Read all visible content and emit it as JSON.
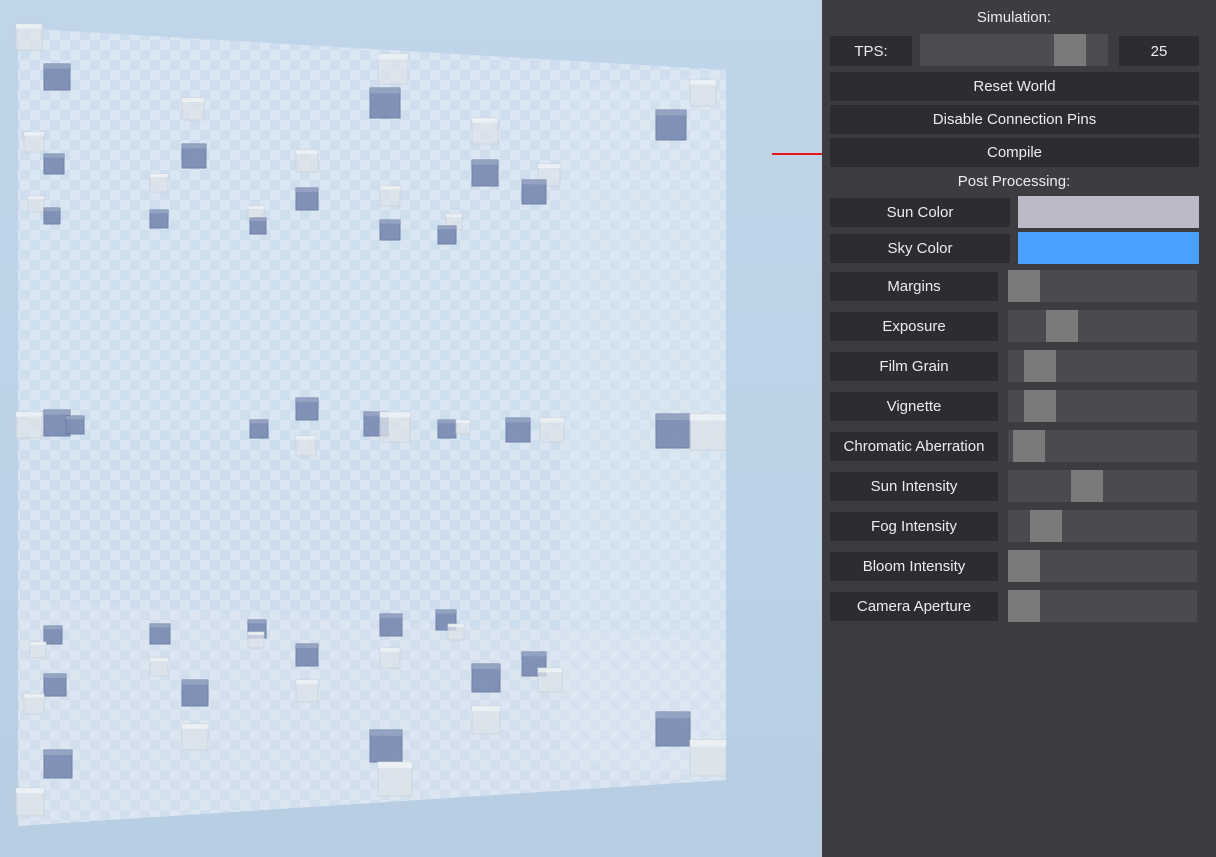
{
  "simulation": {
    "title": "Simulation:",
    "tps_label": "TPS:",
    "tps_value": "25",
    "tps_fraction": 0.86,
    "reset_label": "Reset World",
    "pins_label": "Disable Connection Pins",
    "compile_label": "Compile"
  },
  "post": {
    "title": "Post Processing:",
    "sun_color_label": "Sun Color",
    "sun_color": "#bcbac6",
    "sky_color_label": "Sky Color",
    "sky_color": "#4aa0fe",
    "sliders": [
      {
        "label": "Margins",
        "value": 0.0
      },
      {
        "label": "Exposure",
        "value": 0.24
      },
      {
        "label": "Film Grain",
        "value": 0.1
      },
      {
        "label": "Vignette",
        "value": 0.1
      },
      {
        "label": "Chromatic Aberration",
        "value": 0.03
      },
      {
        "label": "Sun Intensity",
        "value": 0.4
      },
      {
        "label": "Fog Intensity",
        "value": 0.14
      },
      {
        "label": "Bloom Intensity",
        "value": 0.0
      },
      {
        "label": "Camera Aperture",
        "value": 0.0
      }
    ]
  },
  "colors": {
    "panel_bg": "#3b3d41",
    "cell_bg": "#2b2d30",
    "slider_thumb": "#7a7a7a",
    "arrow": "#e8141b",
    "cube_blue": "#7d8db4",
    "cube_ghost": "#dde4ea"
  }
}
